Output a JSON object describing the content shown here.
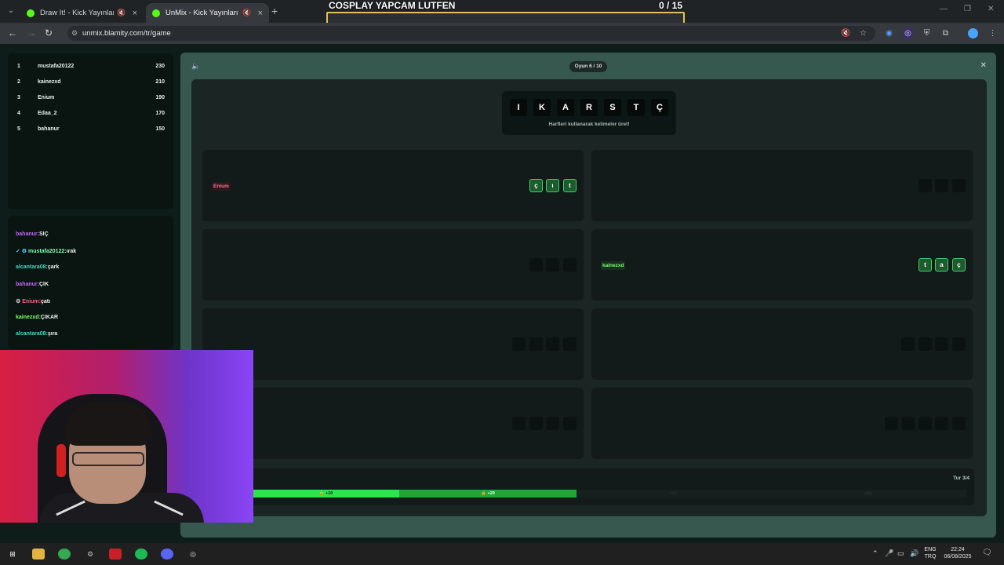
{
  "browser": {
    "tabs": [
      {
        "title": "Draw It! - Kick Yayınları İçin"
      },
      {
        "title": "UnMix - Kick Yayınları İçin"
      }
    ],
    "url": "unmix.blamity.com/tr/game"
  },
  "overlay": {
    "title": "COSPLAY YAPCAM LUTFEN",
    "count": "0 / 15"
  },
  "leaderboard": [
    {
      "rank": "1",
      "name": "mustafa20122",
      "score": "230"
    },
    {
      "rank": "2",
      "name": "kainezxd",
      "score": "210"
    },
    {
      "rank": "3",
      "name": "Enium",
      "score": "190"
    },
    {
      "rank": "4",
      "name": "Edaa_2",
      "score": "170"
    },
    {
      "rank": "5",
      "name": "bahanur",
      "score": "150"
    }
  ],
  "chat": [
    {
      "user": "bahanur:",
      "msg": "SIÇ",
      "color": "#c667ff",
      "badge": ""
    },
    {
      "user": "mustafa20122:",
      "msg": "ırak",
      "color": "#7cffb0",
      "badge": "✓ ⚙"
    },
    {
      "user": "alcantara08:",
      "msg": "çark",
      "color": "#48d8c0",
      "badge": ""
    },
    {
      "user": "bahanur:",
      "msg": "ÇIK",
      "color": "#c667ff",
      "badge": ""
    },
    {
      "user": "Enium:",
      "msg": "çatı",
      "color": "#ff5c8a",
      "badge": "⚙"
    },
    {
      "user": "kainezxd:",
      "msg": "ÇIKAR",
      "color": "#7cff6a",
      "badge": ""
    },
    {
      "user": "alcantara08:",
      "msg": "şıra",
      "color": "#48d8c0",
      "badge": ""
    }
  ],
  "game": {
    "round_label": "Oyun 6 / 10",
    "letters": [
      "I",
      "K",
      "A",
      "R",
      "S",
      "T",
      "Ç"
    ],
    "hint": "Harfleri kullanarak kelimeler üret!",
    "slots": [
      {
        "solver": "Enium",
        "solver_color": "pink",
        "letters": [
          "ç",
          "ı",
          "t"
        ]
      },
      {
        "solver": "",
        "letters": [
          "",
          "",
          ""
        ]
      },
      {
        "solver": "",
        "letters": [
          "",
          "",
          ""
        ]
      },
      {
        "solver": "kainezxd",
        "solver_color": "green",
        "letters": [
          "t",
          "a",
          "ç"
        ]
      },
      {
        "solver": "",
        "letters": [
          "",
          "",
          "",
          ""
        ]
      },
      {
        "solver": "",
        "letters": [
          "",
          "",
          "",
          ""
        ]
      },
      {
        "solver": "",
        "letters": [
          "",
          "",
          "",
          ""
        ]
      },
      {
        "solver": "",
        "letters": [
          "",
          "",
          "",
          "",
          ""
        ]
      }
    ],
    "footer": {
      "tur": "Tur 3/4",
      "segments": [
        "+10",
        "+20",
        "+30",
        "+40"
      ]
    }
  },
  "taskbar": {
    "lang": "ENG\nTRQ",
    "time": "22:24",
    "date": "06/08/2025"
  }
}
